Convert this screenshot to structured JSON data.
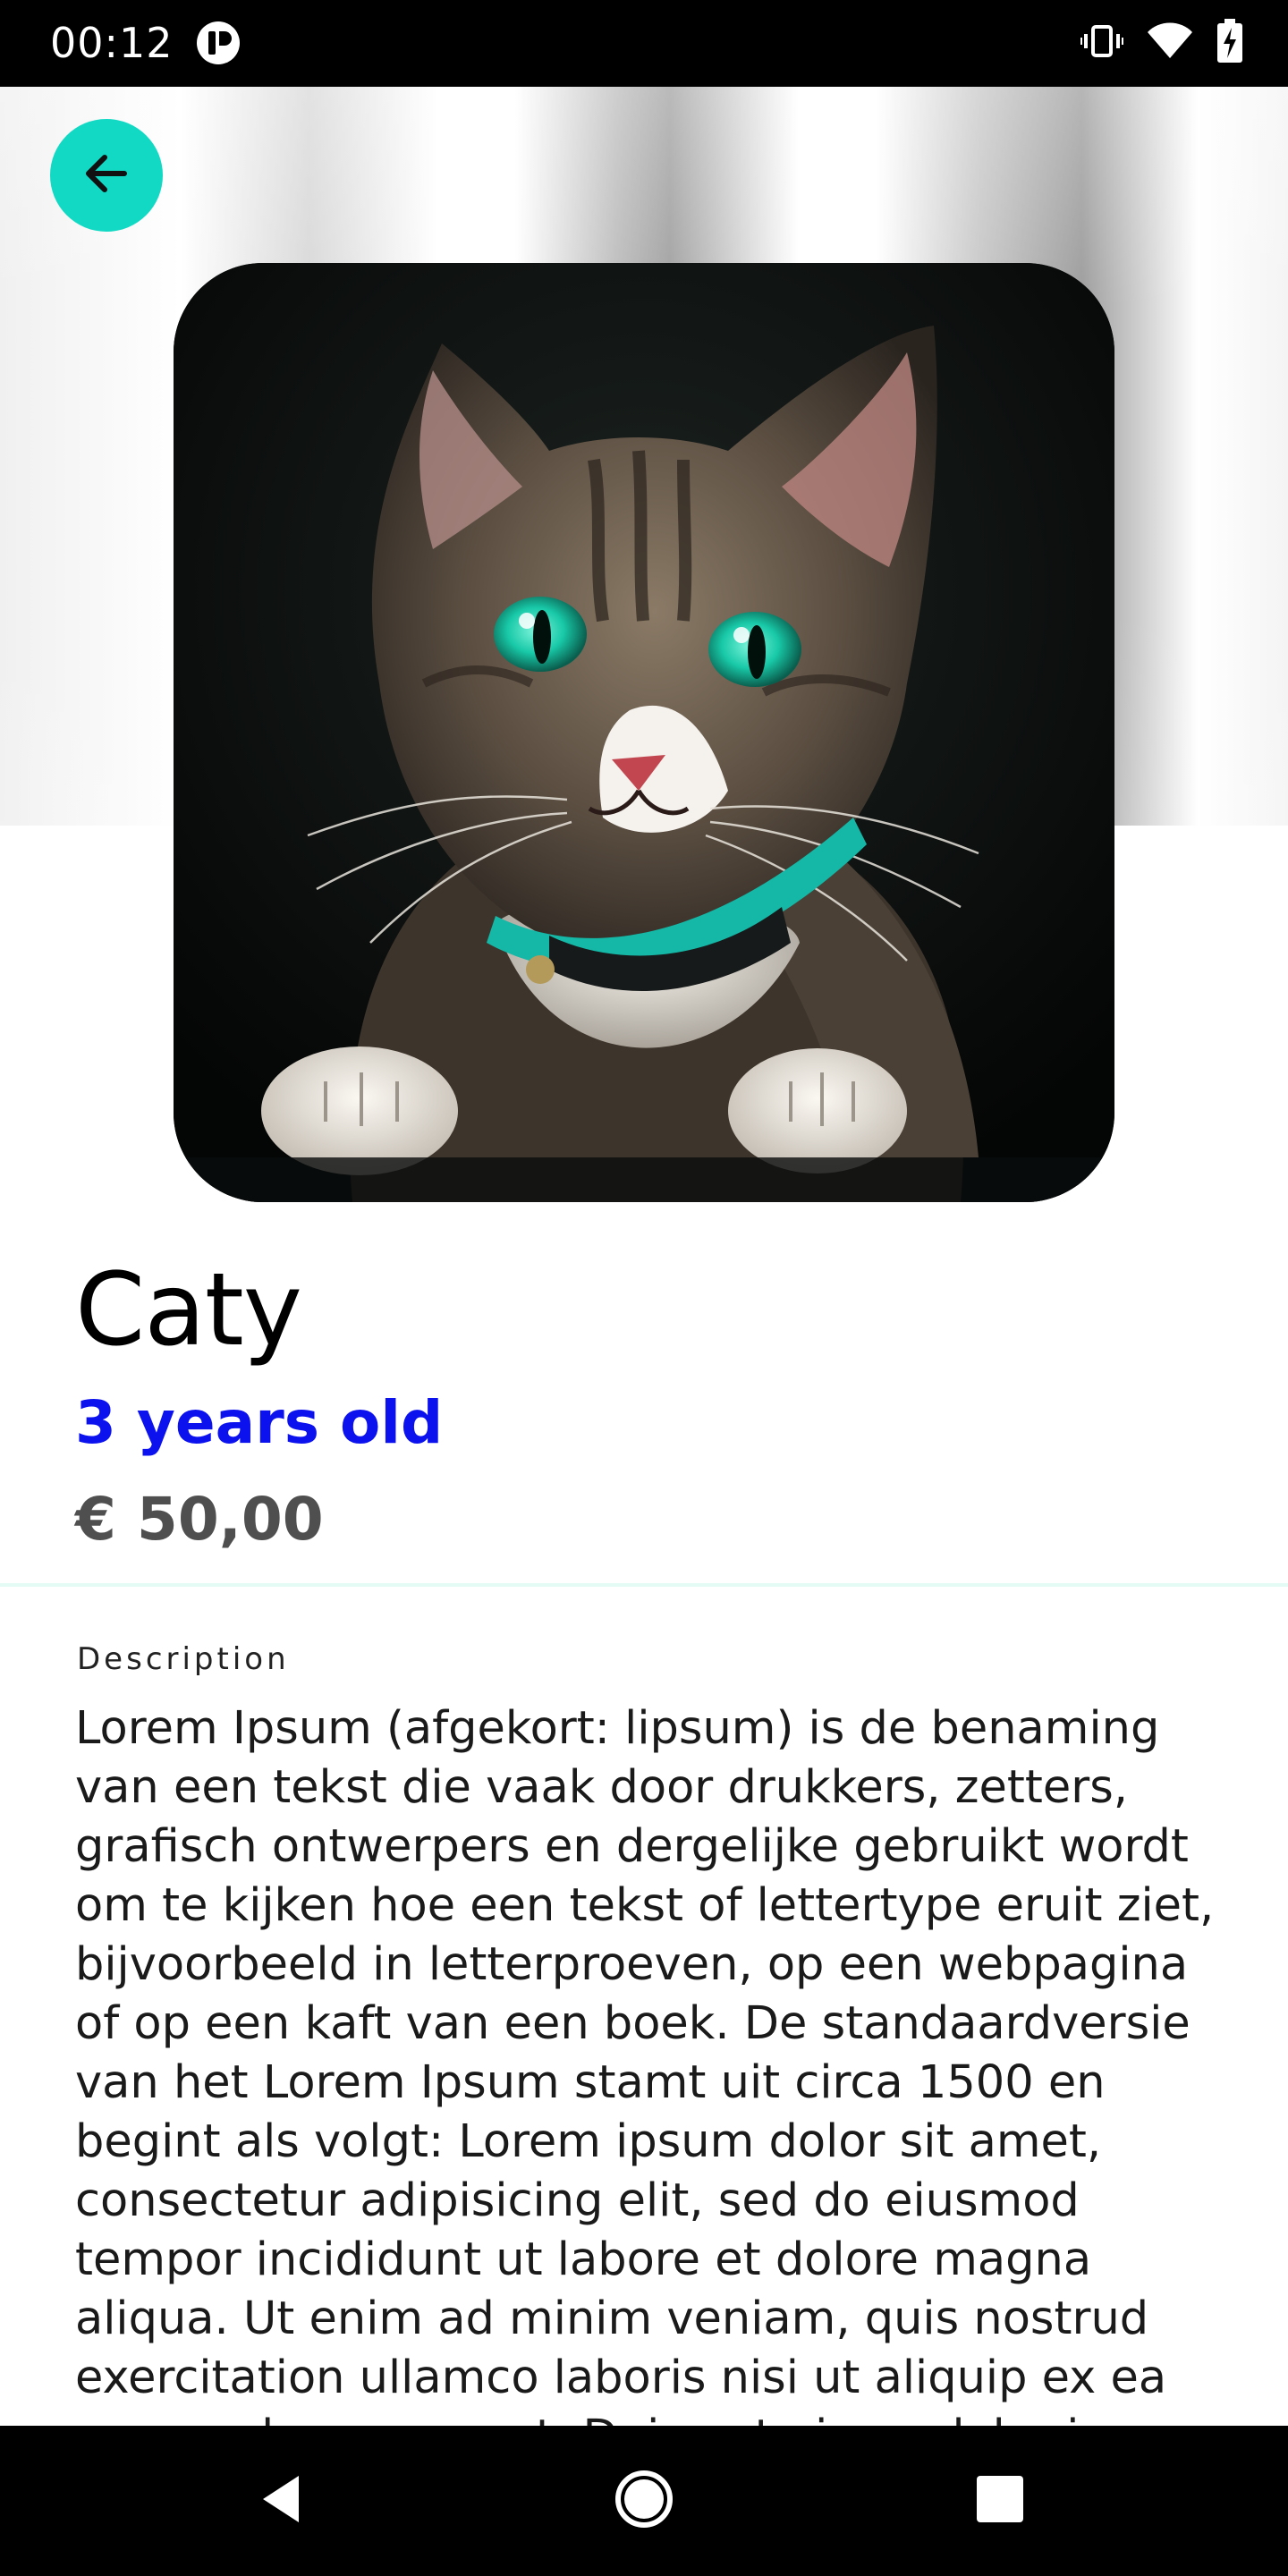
{
  "status_bar": {
    "time": "00:12",
    "icons": [
      "app-notification-icon",
      "vibrate-icon",
      "wifi-icon",
      "battery-icon"
    ]
  },
  "header": {
    "back_icon": "arrow-left-icon",
    "back_color": "#12d9c4"
  },
  "pet": {
    "name": "Caty",
    "age": "3 years old",
    "price": "€ 50,00",
    "description_label": "Description",
    "description": "Lorem Ipsum (afgekort: lipsum) is de benaming van een tekst die vaak door drukkers, zetters, grafisch ontwerpers en dergelijke gebruikt wordt om te kijken hoe een tekst of lettertype eruit ziet, bijvoorbeeld in letterproeven, op een webpagina of op een kaft van een boek. De standaardversie van het Lorem Ipsum stamt uit circa 1500 en begint als volgt: Lorem ipsum dolor sit amet, consectetur adipisicing elit, sed do eiusmod tempor incididunt ut labore et dolore magna aliqua. Ut enim ad minim veniam, quis nostrud exercitation ullamco laboris nisi ut aliquip ex ea commodo consequat. Duis aute irure dolor in reprehenderit in voluptate velit"
  },
  "colors": {
    "accent": "#12d9c4",
    "age": "#0c12ee",
    "price": "#4f4f4f"
  },
  "nav_bar": {
    "icons": [
      "back-triangle-icon",
      "home-circle-icon",
      "recents-square-icon"
    ]
  }
}
